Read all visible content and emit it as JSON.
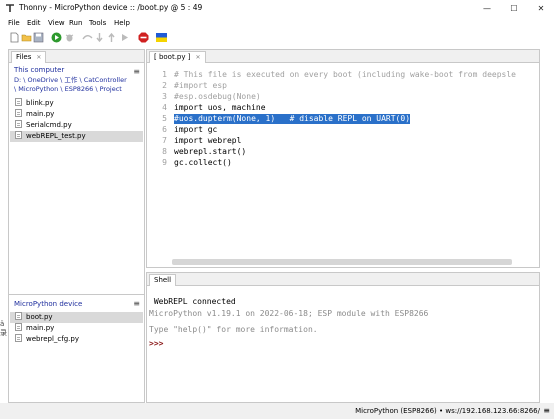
{
  "window": {
    "app_icon": "Th",
    "title": "Thonny  -  MicroPython device :: /boot.py  @  5 : 49",
    "minimize": "—",
    "maximize": "☐",
    "close": "✕"
  },
  "menu": [
    "File",
    "Edit",
    "View",
    "Run",
    "Tools",
    "Help"
  ],
  "toolbar": {
    "icons": [
      "new-file-icon",
      "open-file-icon",
      "save-icon",
      "run-icon",
      "debug-icon",
      "step-over-icon",
      "step-into-icon",
      "step-out-icon",
      "resume-icon",
      "stop-icon",
      "ukraine-flag-icon"
    ],
    "colors": {
      "run": "#2e9a2e",
      "stop": "#d02020",
      "flag_blue": "#1f5bd6",
      "flag_yellow": "#f5d400"
    }
  },
  "files": {
    "tab_label": "Files",
    "computer": {
      "title": "This computer",
      "path_line1": "D: \\ OneDrive \\ 工作 \\ CatController",
      "path_line2": "\\ MicroPython \\ ESP8266 \\ Project",
      "files": [
        "blink.py",
        "main.py",
        "Serialcmd.py",
        "webREPL_test.py"
      ]
    },
    "device": {
      "title": "MicroPython device",
      "files": [
        "boot.py",
        "main.py",
        "webrepl_cfg.py"
      ]
    },
    "menu_icon": "≡"
  },
  "editor": {
    "tab_label": "[ boot.py ]",
    "line_numbers": [
      "1",
      "2",
      "3",
      "4",
      "5",
      "6",
      "7",
      "8",
      "9"
    ],
    "lines": [
      "# This file is executed on every boot (including wake-boot from deepsle",
      "#import esp",
      "#esp.osdebug(None)",
      "import uos, machine",
      "#uos.dupterm(None, 1)   # disable REPL on UART(0)",
      "import gc",
      "import webrepl",
      "webrepl.start()",
      "gc.collect()"
    ]
  },
  "shell": {
    "tab_label": "Shell",
    "lines": [
      " WebREPL connected",
      "MicroPython v1.19.1 on 2022-06-18; ESP module with ESP8266",
      "Type \"help()\" for more information."
    ],
    "prompt": ">>>"
  },
  "status": {
    "interpreter": "MicroPython (ESP8266)  •  ws://192.168.123.66:8266/",
    "menu_icon": "≡"
  },
  "left_edge": [
    "ä",
    "录"
  ]
}
